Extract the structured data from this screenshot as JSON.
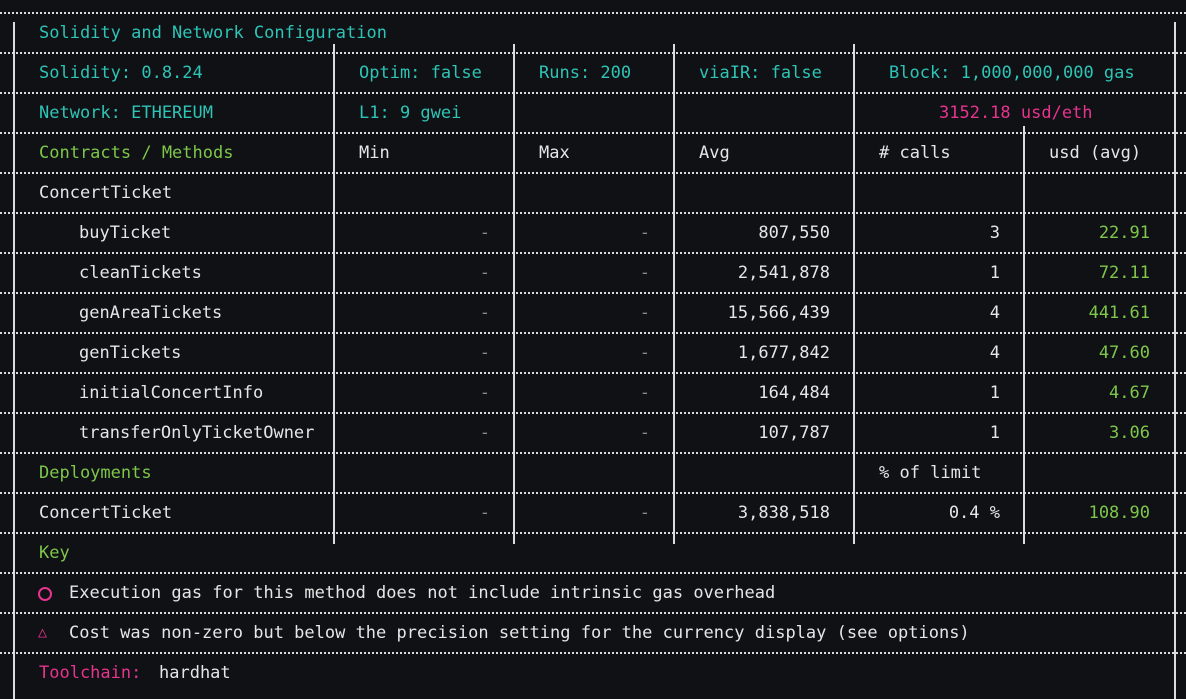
{
  "header": {
    "title": "Solidity and Network Configuration"
  },
  "config": {
    "solidity": "Solidity: 0.8.24",
    "optim": "Optim: false",
    "runs": "Runs: 200",
    "via_ir": "viaIR: false",
    "block": "Block: 1,000,000,000 gas",
    "network": "Network: ETHEREUM",
    "l1": "L1: 9 gwei",
    "eth_price": "3152.18 usd/eth"
  },
  "methods_table": {
    "columns": [
      "Contracts / Methods",
      "Min",
      "Max",
      "Avg",
      "# calls",
      "usd (avg)"
    ],
    "contract": "ConcertTicket",
    "rows": [
      {
        "name": "buyTicket",
        "min": "-",
        "max": "-",
        "avg": "807,550",
        "calls": "3",
        "usd": "22.91"
      },
      {
        "name": "cleanTickets",
        "min": "-",
        "max": "-",
        "avg": "2,541,878",
        "calls": "1",
        "usd": "72.11"
      },
      {
        "name": "genAreaTickets",
        "min": "-",
        "max": "-",
        "avg": "15,566,439",
        "calls": "4",
        "usd": "441.61"
      },
      {
        "name": "genTickets",
        "min": "-",
        "max": "-",
        "avg": "1,677,842",
        "calls": "4",
        "usd": "47.60"
      },
      {
        "name": "initialConcertInfo",
        "min": "-",
        "max": "-",
        "avg": "164,484",
        "calls": "1",
        "usd": "4.67"
      },
      {
        "name": "transferOnlyTicketOwner",
        "min": "-",
        "max": "-",
        "avg": "107,787",
        "calls": "1",
        "usd": "3.06"
      }
    ]
  },
  "deployments": {
    "label": "Deployments",
    "limit_header": "% of limit",
    "rows": [
      {
        "name": "ConcertTicket",
        "min": "-",
        "max": "-",
        "avg": "3,838,518",
        "limit": "0.4 %",
        "usd": "108.90"
      }
    ]
  },
  "key": {
    "label": "Key",
    "items": [
      {
        "icon": "circle-icon",
        "text": "Execution gas for this method does not include intrinsic gas overhead"
      },
      {
        "icon": "triangle-icon",
        "text": "Cost was non-zero but below the precision setting for the currency display (see options)"
      }
    ]
  },
  "toolchain": {
    "label": "Toolchain:",
    "value": "hardhat"
  },
  "colors": {
    "background": "#0f1115",
    "teal": "#2ec4b6",
    "green": "#7ec74a",
    "magenta": "#e8338f",
    "border": "#dcdcdc"
  }
}
